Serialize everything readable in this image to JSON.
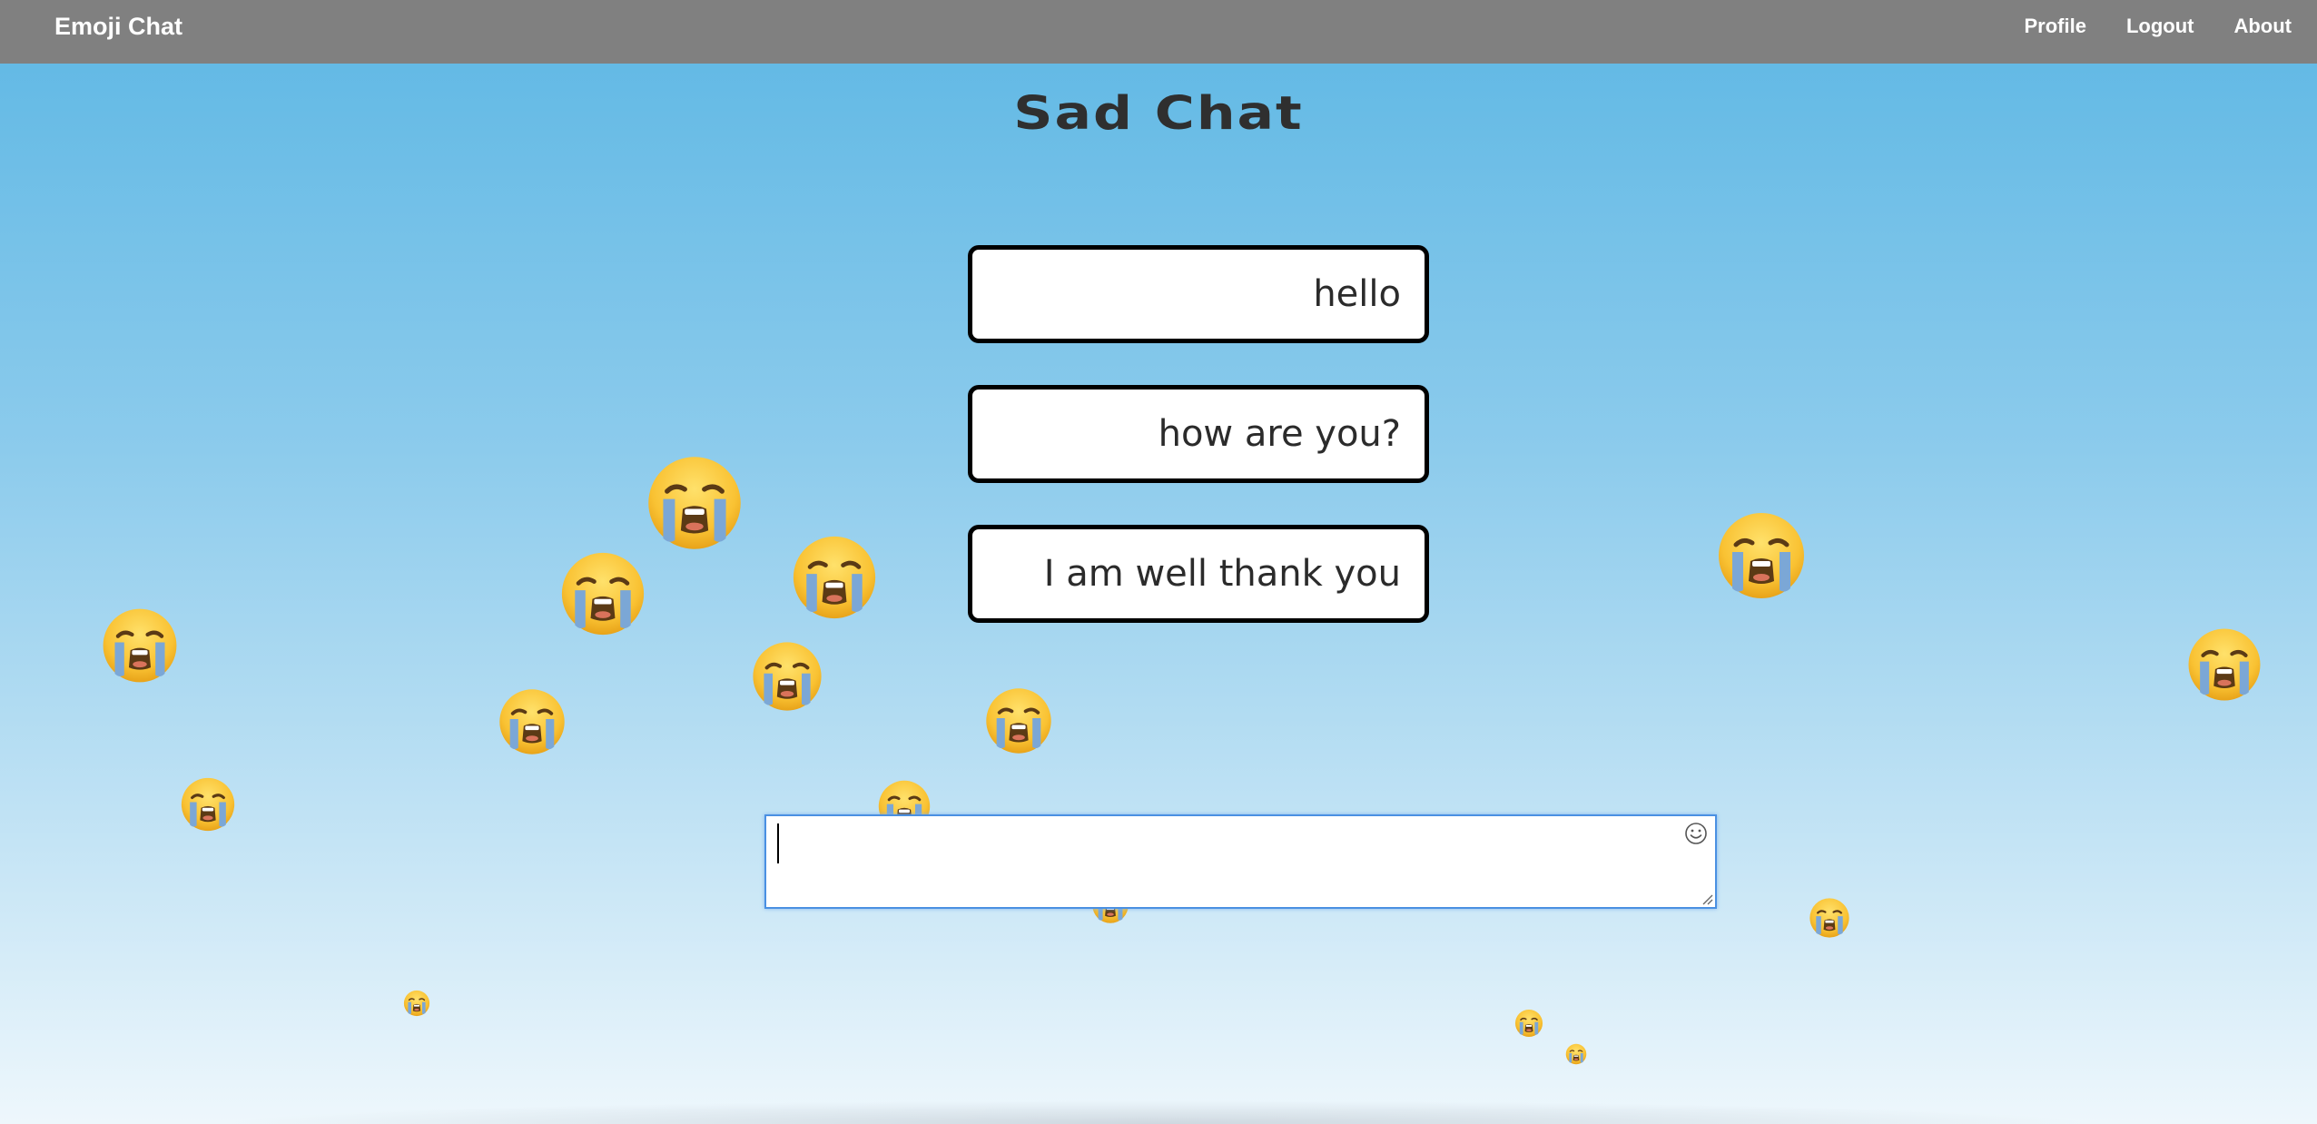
{
  "navbar": {
    "brand": "Emoji Chat",
    "links": [
      "Profile",
      "Logout",
      "About"
    ],
    "background": "#808080"
  },
  "page": {
    "title": "Sad Chat"
  },
  "messages": [
    {
      "text": "hello"
    },
    {
      "text": "how are you?"
    },
    {
      "text": "I am well thank you"
    }
  ],
  "composer": {
    "value": "",
    "accent": "#4a90e2",
    "icon": "smiley-icon"
  },
  "decoration": {
    "emoji_icon": "loudly-crying-face-icon"
  }
}
